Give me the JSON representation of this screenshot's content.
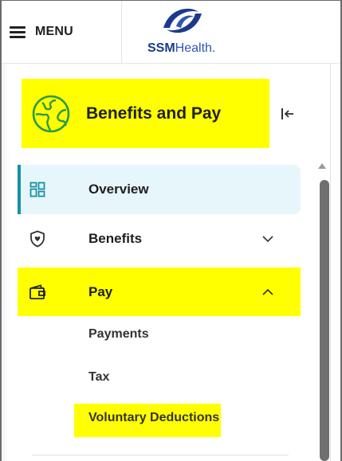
{
  "header": {
    "menu_label": "MENU",
    "logo_bold": "SSM",
    "logo_light": "Health."
  },
  "app": {
    "title": "Benefits and Pay"
  },
  "nav": {
    "items": [
      {
        "label": "Overview",
        "icon": "dashboard-grid-icon",
        "active": true
      },
      {
        "label": "Benefits",
        "icon": "shield-heart-icon",
        "expanded": false
      },
      {
        "label": "Pay",
        "icon": "wallet-icon",
        "expanded": true
      }
    ],
    "pay_subitems": [
      "Payments",
      "Tax",
      "Voluntary Deductions"
    ]
  },
  "colors": {
    "highlight": "#ffff00",
    "active_bg": "#e7f6fb",
    "active_accent": "#1591a5",
    "brand_blue": "#1b3a8c"
  }
}
